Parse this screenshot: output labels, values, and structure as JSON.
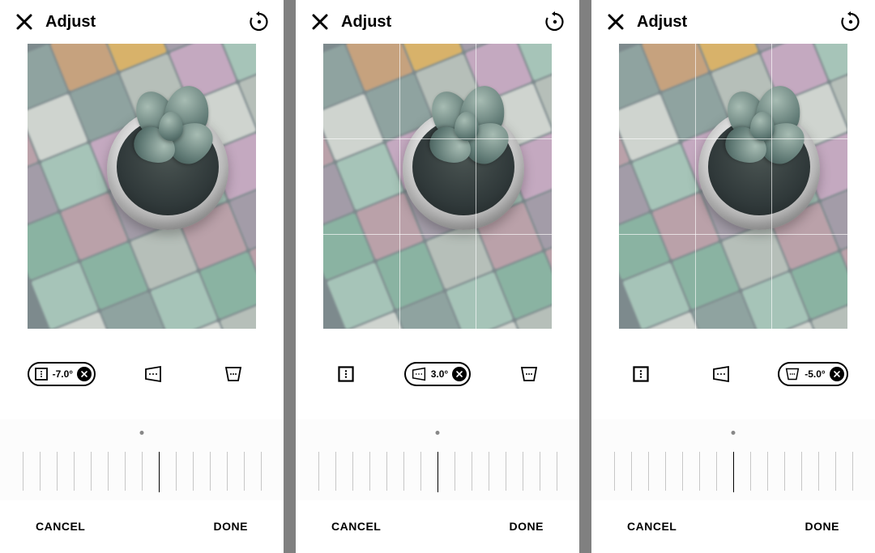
{
  "panels": [
    {
      "header": {
        "title": "Adjust"
      },
      "tools": {
        "active_index": 0,
        "value": "-7.0°"
      },
      "grid": false,
      "ruler": {
        "main_tick_offset": 8
      },
      "footer": {
        "cancel": "CANCEL",
        "done": "DONE"
      }
    },
    {
      "header": {
        "title": "Adjust"
      },
      "tools": {
        "active_index": 1,
        "value": "3.0°"
      },
      "grid": true,
      "ruler": {
        "main_tick_offset": 7
      },
      "footer": {
        "cancel": "CANCEL",
        "done": "DONE"
      }
    },
    {
      "header": {
        "title": "Adjust"
      },
      "tools": {
        "active_index": 2,
        "value": "-5.0°"
      },
      "grid": true,
      "ruler": {
        "main_tick_offset": 7
      },
      "footer": {
        "cancel": "CANCEL",
        "done": "DONE"
      }
    }
  ]
}
